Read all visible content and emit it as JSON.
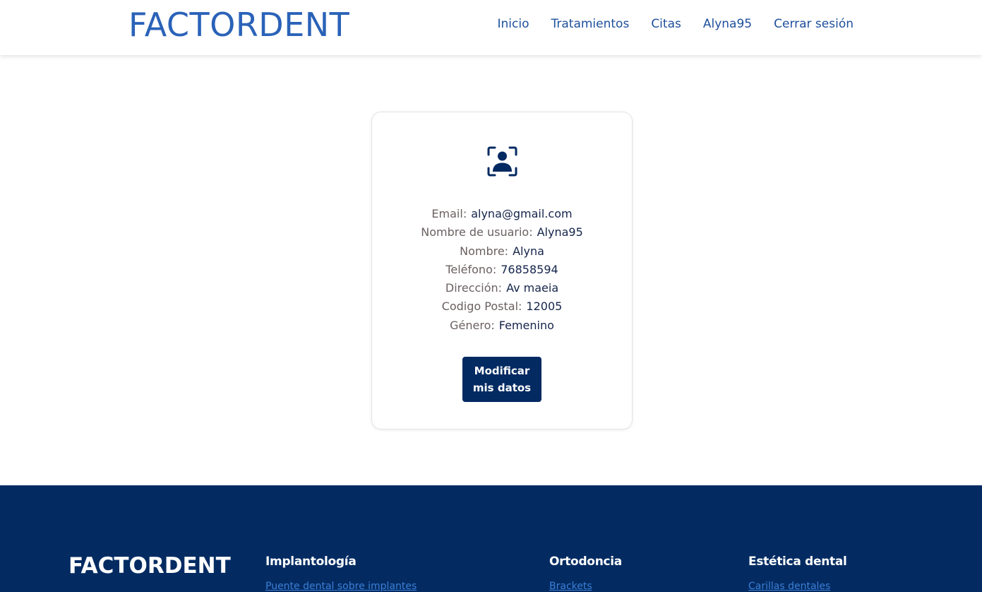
{
  "header": {
    "brand": "FACTORDENT",
    "nav": {
      "inicio": "Inicio",
      "tratamientos": "Tratamientos",
      "citas": "Citas",
      "user": "Alyna95",
      "logout": "Cerrar sesión"
    }
  },
  "profile": {
    "icon": "user-profile-icon",
    "fields": [
      {
        "label": "Email:",
        "value": "alyna@gmail.com"
      },
      {
        "label": "Nombre de usuario:",
        "value": "Alyna95"
      },
      {
        "label": "Nombre:",
        "value": "Alyna"
      },
      {
        "label": "Teléfono:",
        "value": "76858594"
      },
      {
        "label": "Dirección:",
        "value": "Av maeia"
      },
      {
        "label": "Codigo Postal:",
        "value": "12005"
      },
      {
        "label": "Género:",
        "value": "Femenino"
      }
    ],
    "edit_button": "Modificar mis datos"
  },
  "footer": {
    "brand": "FACTORDENT",
    "columns": [
      {
        "heading": "Implantología",
        "link": "Puente dental sobre implantes"
      },
      {
        "heading": "Ortodoncia",
        "link": "Brackets"
      },
      {
        "heading": "Estética dental",
        "link": "Carillas dentales"
      }
    ]
  },
  "colors": {
    "brand_blue": "#2a62b8",
    "nav_blue": "#1e4f9c",
    "dark_navy": "#042a62",
    "footer_link": "#3b7fd6"
  }
}
